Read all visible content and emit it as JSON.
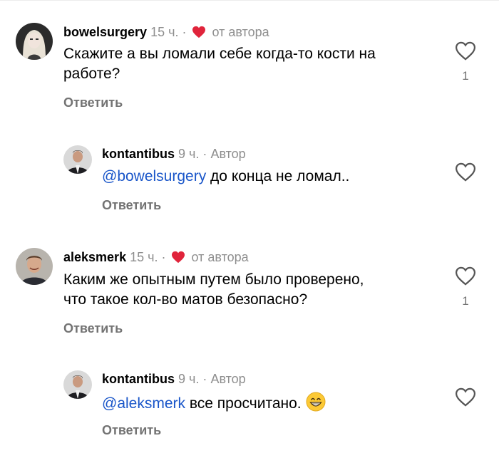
{
  "comments": [
    {
      "username": "bowelsurgery",
      "time": "15 ч.",
      "separator": "·",
      "author_tag": "от автора",
      "author_liked": true,
      "text_lines": [
        "Скажите а вы ломали себе когда-то кости на",
        "работе?"
      ],
      "reply_label": "Ответить",
      "like_count": "1",
      "avatar_icon": "blonde-woman-avatar"
    },
    {
      "username": "kontantibus",
      "time": "9 ч.",
      "separator": "·",
      "author_tag": "Автор",
      "mention": "@bowelsurgery",
      "text": " до конца не ломал..",
      "reply_label": "Ответить",
      "avatar_icon": "man-in-suit-avatar"
    },
    {
      "username": "aleksmerk",
      "time": "15 ч.",
      "separator": "·",
      "author_tag": "от автора",
      "author_liked": true,
      "text_lines": [
        "Каким же опытным путем было проверено,",
        "что такое кол-во матов безопасно?"
      ],
      "reply_label": "Ответить",
      "like_count": "1",
      "avatar_icon": "smiling-man-avatar"
    },
    {
      "username": "kontantibus",
      "time": "9 ч.",
      "separator": "·",
      "author_tag": "Автор",
      "mention": "@aleksmerk",
      "text": " все просчитано.",
      "emoji": "grinning-face-emoji",
      "reply_label": "Ответить",
      "avatar_icon": "man-in-suit-avatar"
    }
  ],
  "colors": {
    "heart_red": "#e0243b",
    "mention_blue": "#1a56c9",
    "meta_gray": "#8e8e8e"
  }
}
